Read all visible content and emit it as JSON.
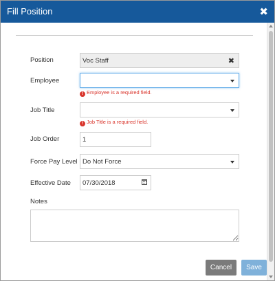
{
  "dialog": {
    "title": "Fill Position",
    "close_symbol": "✖"
  },
  "form": {
    "position": {
      "label": "Position",
      "value": "Voc Staff",
      "clear_symbol": "✖"
    },
    "employee": {
      "label": "Employee",
      "value": "",
      "error": "Employee is a required field."
    },
    "job_title": {
      "label": "Job Title",
      "value": "",
      "error": "Job Title is a required field."
    },
    "job_order": {
      "label": "Job Order",
      "value": "1"
    },
    "force_pay_level": {
      "label": "Force Pay Level",
      "value": "Do Not Force"
    },
    "effective_date": {
      "label": "Effective Date",
      "value": "07/30/2018"
    },
    "notes": {
      "label": "Notes",
      "value": ""
    }
  },
  "error_icon_symbol": "!",
  "buttons": {
    "cancel": "Cancel",
    "save": "Save"
  },
  "colors": {
    "header": "#16599b",
    "error": "#d9342b",
    "cancel_button": "#7b7b7b",
    "save_button": "#7fb1da",
    "focus_border": "#66afe9"
  },
  "icons": {
    "close": "close-icon",
    "clear": "clear-icon",
    "dropdown": "chevron-down-icon",
    "error": "exclamation-circle-icon",
    "calendar": "calendar-icon"
  }
}
